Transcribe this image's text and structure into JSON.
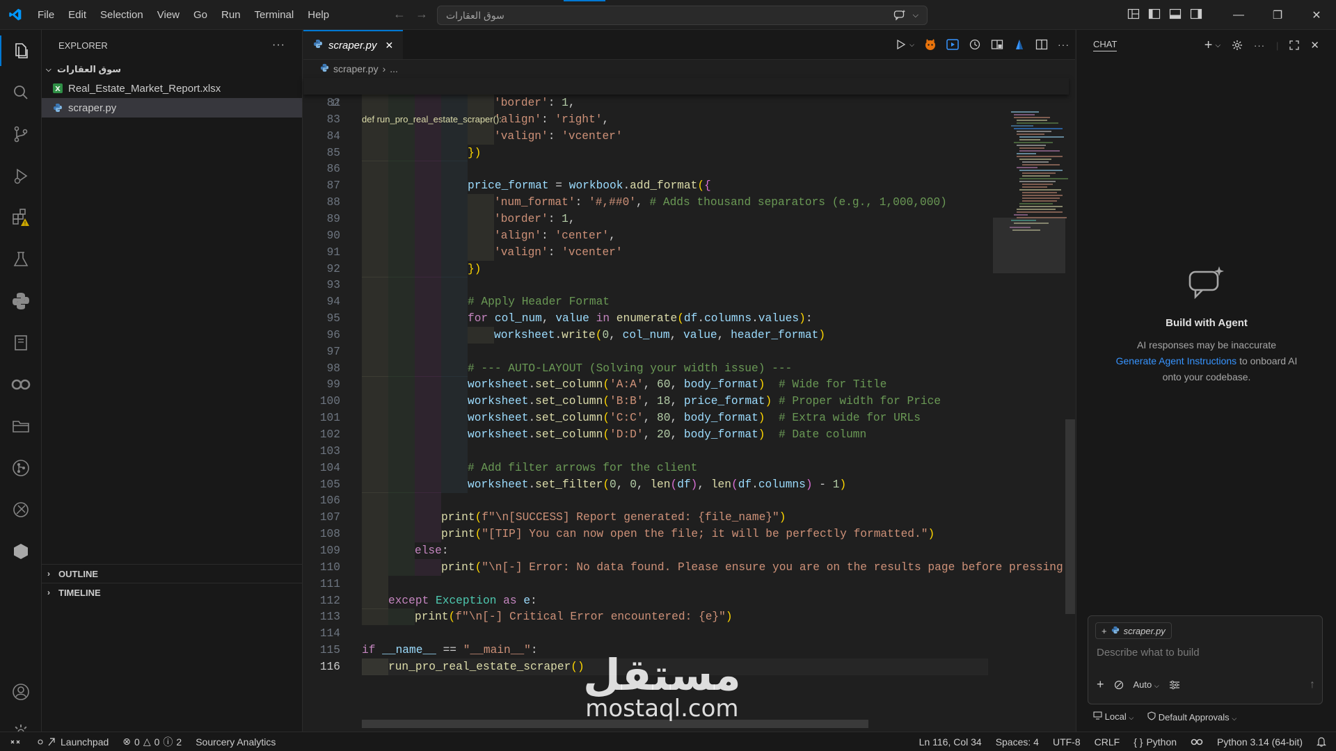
{
  "titlebar": {
    "menu": [
      "File",
      "Edit",
      "Selection",
      "View",
      "Go",
      "Run",
      "Terminal",
      "Help"
    ],
    "search_text": "سوق العقارات",
    "accent": "#0078d4"
  },
  "activity": {
    "icons": [
      "explorer-icon",
      "search-icon",
      "source-control-icon",
      "run-debug-icon",
      "extensions-icon",
      "testing-icon",
      "python-icon",
      "notebook-icon",
      "copilot-icon",
      "folder-icon",
      "git-graph-icon",
      "remote-explorer-icon",
      "hexagon-icon",
      "account-icon",
      "settings-gear-icon"
    ]
  },
  "sidebar": {
    "title": "EXPLORER",
    "more": "···",
    "folder": "سوق العقارات",
    "files": [
      {
        "name": "Real_Estate_Market_Report.xlsx",
        "icon": "excel-file-icon"
      },
      {
        "name": "scraper.py",
        "icon": "python-file-icon",
        "selected": true
      }
    ],
    "outline": "OUTLINE",
    "timeline": "TIMELINE"
  },
  "editor": {
    "tab": "scraper.py",
    "breadcrumb_file": "scraper.py",
    "breadcrumb_more": "...",
    "sticky_line_number": "11",
    "sticky_line": "def run_pro_real_estate_scraper():",
    "lines": [
      {
        "n": "82",
        "indent": 5,
        "text": "'border': 1,"
      },
      {
        "n": "83",
        "indent": 5,
        "text": "'align': 'right',"
      },
      {
        "n": "84",
        "indent": 5,
        "text": "'valign': 'vcenter'"
      },
      {
        "n": "85",
        "indent": 4,
        "text": "})"
      },
      {
        "n": "86",
        "indent": 4,
        "text": ""
      },
      {
        "n": "87",
        "indent": 4,
        "text": "price_format = workbook.add_format({"
      },
      {
        "n": "88",
        "indent": 5,
        "text": "'num_format': '#,##0', # Adds thousand separators (e.g., 1,000,000)"
      },
      {
        "n": "89",
        "indent": 5,
        "text": "'border': 1,"
      },
      {
        "n": "90",
        "indent": 5,
        "text": "'align': 'center',"
      },
      {
        "n": "91",
        "indent": 5,
        "text": "'valign': 'vcenter'"
      },
      {
        "n": "92",
        "indent": 4,
        "text": "})"
      },
      {
        "n": "93",
        "indent": 4,
        "text": ""
      },
      {
        "n": "94",
        "indent": 4,
        "text": "# Apply Header Format"
      },
      {
        "n": "95",
        "indent": 4,
        "text": "for col_num, value in enumerate(df.columns.values):"
      },
      {
        "n": "96",
        "indent": 5,
        "text": "worksheet.write(0, col_num, value, header_format)"
      },
      {
        "n": "97",
        "indent": 4,
        "text": ""
      },
      {
        "n": "98",
        "indent": 4,
        "text": "# --- AUTO-LAYOUT (Solving your width issue) ---"
      },
      {
        "n": "99",
        "indent": 4,
        "text": "worksheet.set_column('A:A', 60, body_format)  # Wide for Title"
      },
      {
        "n": "100",
        "indent": 4,
        "text": "worksheet.set_column('B:B', 18, price_format) # Proper width for Price"
      },
      {
        "n": "101",
        "indent": 4,
        "text": "worksheet.set_column('C:C', 80, body_format)  # Extra wide for URLs"
      },
      {
        "n": "102",
        "indent": 4,
        "text": "worksheet.set_column('D:D', 20, body_format)  # Date column"
      },
      {
        "n": "103",
        "indent": 4,
        "text": ""
      },
      {
        "n": "104",
        "indent": 4,
        "text": "# Add filter arrows for the client"
      },
      {
        "n": "105",
        "indent": 4,
        "text": "worksheet.set_filter(0, 0, len(df), len(df.columns) - 1)"
      },
      {
        "n": "106",
        "indent": 3,
        "text": ""
      },
      {
        "n": "107",
        "indent": 3,
        "text": "print(f\"\\n[SUCCESS] Report generated: {file_name}\")"
      },
      {
        "n": "108",
        "indent": 3,
        "text": "print(\"[TIP] You can now open the file; it will be perfectly formatted.\")"
      },
      {
        "n": "109",
        "indent": 2,
        "text": "else:"
      },
      {
        "n": "110",
        "indent": 3,
        "text": "print(\"\\n[-] Error: No data found. Please ensure you are on the results page before pressing"
      },
      {
        "n": "111",
        "indent": 1,
        "text": ""
      },
      {
        "n": "112",
        "indent": 1,
        "text": "except Exception as e:"
      },
      {
        "n": "113",
        "indent": 2,
        "text": "print(f\"\\n[-] Critical Error encountered: {e}\")"
      },
      {
        "n": "114",
        "indent": 0,
        "text": ""
      },
      {
        "n": "115",
        "indent": 0,
        "text": "if __name__ == \"__main__\":"
      },
      {
        "n": "116",
        "indent": 1,
        "text": "run_pro_real_estate_scraper()",
        "active": true
      }
    ]
  },
  "watermark": {
    "arabic": "مستقل",
    "latin": "mostaql.com"
  },
  "chat": {
    "title": "CHAT",
    "heading": "Build with Agent",
    "line1": "AI responses may be inaccurate",
    "link": "Generate Agent Instructions",
    "line2a": "to onboard AI",
    "line3": "onto your codebase.",
    "context_file": "scraper.py",
    "placeholder": "Describe what to build",
    "mode": "Auto",
    "location": "Local",
    "approvals": "Default Approvals"
  },
  "statusbar": {
    "launchpad": "Launchpad",
    "errors": "0",
    "warnings": "0",
    "infos": "2",
    "sourcery": "Sourcery Analytics",
    "position": "Ln 116, Col 34",
    "spaces": "Spaces: 4",
    "encoding": "UTF-8",
    "eol": "CRLF",
    "language": "Python",
    "interpreter": "Python 3.14 (64-bit)"
  }
}
